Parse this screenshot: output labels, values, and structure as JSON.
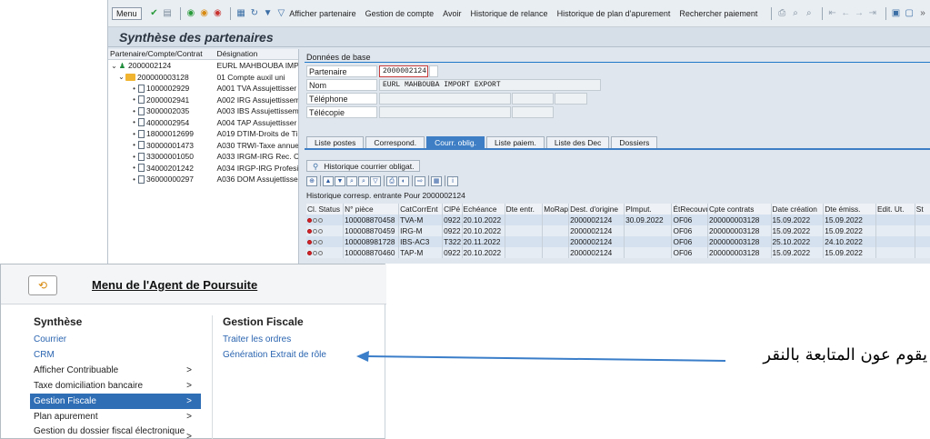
{
  "toolbar": {
    "menu_label": "Menu",
    "items": [
      "Afficher partenaire",
      "Gestion de compte",
      "Avoir",
      "Historique de relance",
      "Historique de plan d'apurement",
      "Rechercher paiement"
    ]
  },
  "title": "Synthèse des partenaires",
  "tree": {
    "col1": "Partenaire/Compte/Contrat",
    "col2": "Désignation",
    "rows": [
      {
        "id": "2000002124",
        "desc": "EURL MAHBOUBA IMPO"
      },
      {
        "id": "200000003128",
        "desc": "01 Compte auxil uni"
      },
      {
        "id": "1000002929",
        "desc": "A001 TVA Assujettisser"
      },
      {
        "id": "2000002941",
        "desc": "A002 IRG Assujettissem"
      },
      {
        "id": "3000002035",
        "desc": "A003 IBS Assujettissem"
      },
      {
        "id": "4000002954",
        "desc": "A004 TAP Assujettisser"
      },
      {
        "id": "18000012699",
        "desc": "A019 DTIM-Droits de Ti"
      },
      {
        "id": "30000001473",
        "desc": "A030 TRWI-Taxe annue"
      },
      {
        "id": "33000001050",
        "desc": "A033 IRGM-IRG Rec. Ca"
      },
      {
        "id": "34000201242",
        "desc": "A034 IRGP-IRG Profesio"
      },
      {
        "id": "36000000297",
        "desc": "A036 DOM Assujettisse"
      }
    ]
  },
  "base": {
    "title": "Données de base",
    "partner_label": "Partenaire",
    "partner_value": "2000002124",
    "name_label": "Nom",
    "name_value": "EURL MAHBOUBA IMPORT EXPORT",
    "phone_label": "Téléphone",
    "fax_label": "Télécopie"
  },
  "tabs": [
    "Liste postes",
    "Correspond.",
    "Courr. oblig.",
    "Liste paiem.",
    "Liste des Dec",
    "Dossiers"
  ],
  "active_tab": "Courr. oblig.",
  "history_button": "Historique courrier obligat.",
  "grid_caption": "Historique corresp. entrante Pour 2000002124",
  "grid": {
    "headers": [
      "Cl. Status",
      "N° pièce",
      "CatCorrEnt",
      "ClPé",
      "Echéance",
      "Dte entr.",
      "MoRap",
      "Dest. d'origine",
      "PImput.",
      "ÉtRecouvr.",
      "Cpte contrats",
      "Date création",
      "Dte émiss.",
      "Edit. Ut.",
      "St"
    ],
    "rows": [
      [
        "",
        "100008870458",
        "TVA-M",
        "0922",
        "20.10.2022",
        "",
        "",
        "2000002124",
        "30.09.2022",
        "OF06",
        "200000003128",
        "15.09.2022",
        "15.09.2022",
        "",
        ""
      ],
      [
        "",
        "100008870459",
        "IRG-M",
        "0922",
        "20.10.2022",
        "",
        "",
        "2000002124",
        "",
        "OF06",
        "200000003128",
        "15.09.2022",
        "15.09.2022",
        "",
        ""
      ],
      [
        "",
        "100008981728",
        "IBS-AC3",
        "T322",
        "20.11.2022",
        "",
        "",
        "2000002124",
        "",
        "OF06",
        "200000003128",
        "25.10.2022",
        "24.10.2022",
        "",
        ""
      ],
      [
        "",
        "100008870460",
        "TAP-M",
        "0922",
        "20.10.2022",
        "",
        "",
        "2000002124",
        "",
        "OF06",
        "200000003128",
        "15.09.2022",
        "15.09.2022",
        "",
        ""
      ]
    ]
  },
  "menu": {
    "title": "Menu de l'Agent de Poursuite",
    "left_heading": "Synthèse",
    "left_links": [
      "Courrier",
      "CRM"
    ],
    "left_items": [
      {
        "label": "Afficher Contribuable",
        "arrow": ">"
      },
      {
        "label": "Taxe domiciliation bancaire",
        "arrow": ">"
      },
      {
        "label": "Gestion Fiscale",
        "arrow": ">"
      },
      {
        "label": "Plan apurement",
        "arrow": ">"
      },
      {
        "label": "Gestion du dossier fiscal électronique",
        "arrow": ">"
      }
    ],
    "active_item": "Gestion Fiscale",
    "right_heading": "Gestion Fiscale",
    "right_links": [
      "Traiter les ordres",
      "Génération Extrait de rôle"
    ]
  },
  "annotation": {
    "text": "يقوم عون المتابعة بالنقر"
  },
  "colors": {
    "accent": "#2f6db5",
    "link": "#2a64b0",
    "arrow": "#3a7dc9"
  }
}
